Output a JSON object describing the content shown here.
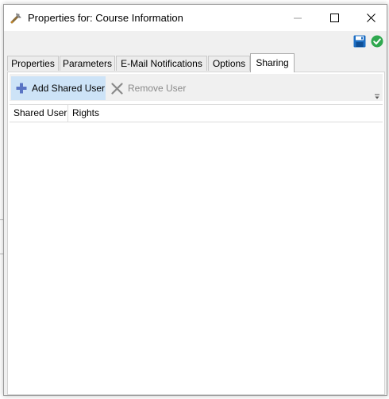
{
  "window": {
    "title": "Properties for: Course Information",
    "controls": [
      "minimize",
      "maximize",
      "close"
    ]
  },
  "header_actions": {
    "save_icon": "save-disk-icon",
    "ok_icon": "green-check-icon"
  },
  "tabs": [
    {
      "label": "Properties",
      "active": false
    },
    {
      "label": "Parameters",
      "active": false
    },
    {
      "label": "E-Mail Notifications",
      "active": false
    },
    {
      "label": "Options",
      "active": false
    },
    {
      "label": "Sharing",
      "active": true
    }
  ],
  "toolbar": {
    "add_label": "Add Shared User",
    "remove_label": "Remove User"
  },
  "grid": {
    "columns": [
      "Shared User",
      "Rights"
    ],
    "rows": []
  },
  "colors": {
    "accent_hover": "#cde3f7",
    "add_icon": "#5a74c4",
    "ok_green": "#2fa84f",
    "save_blue": "#1e6fc4"
  }
}
